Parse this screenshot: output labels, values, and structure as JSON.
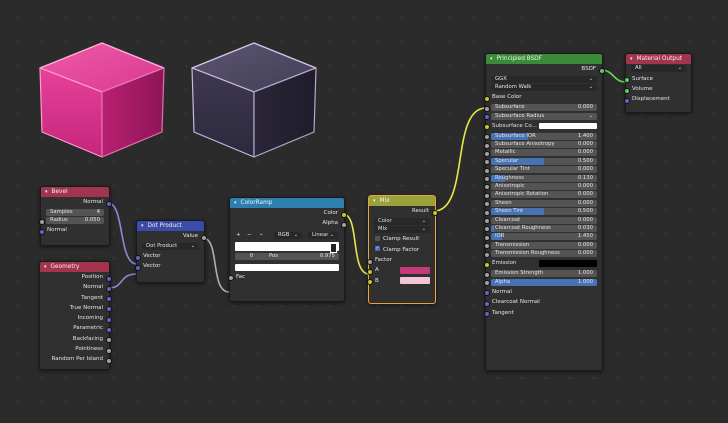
{
  "colors": {
    "bevel": "#a2344d",
    "dot": "#3a4ba8",
    "geometry": "#a2344d",
    "ramp": "#2d7fb0",
    "mix": "#9aa23a",
    "bsdf": "#3a8a3a",
    "output": "#a2344d",
    "pink": "#c53b7a",
    "pink_light": "#f2c4d9",
    "white": "#ffffff",
    "black": "#000000"
  },
  "bevel": {
    "title": "Bevel",
    "out_normal": "Normal",
    "samples_label": "Samples",
    "samples_value": "4",
    "radius_label": "Radius",
    "radius_value": "0.050",
    "in_normal": "Normal"
  },
  "geometry": {
    "title": "Geometry",
    "outputs": [
      "Position",
      "Normal",
      "Tangent",
      "True Normal",
      "Incoming",
      "Parametric",
      "Backfacing",
      "Pointiness",
      "Random Per Island"
    ]
  },
  "dot": {
    "title": "Dot Product",
    "out_value": "Value",
    "mode": "Dot Product",
    "in1": "Vector",
    "in2": "Vector"
  },
  "ramp": {
    "title": "ColorRamp",
    "out_color": "Color",
    "out_alpha": "Alpha",
    "plus": "+",
    "minus": "−",
    "mode": "RGB",
    "interp": "Linear",
    "index": "0",
    "pos_label": "Pos",
    "pos_value": "0.975",
    "in_fac": "Fac"
  },
  "mix": {
    "title": "Mix",
    "out_result": "Result",
    "type": "Color",
    "blend": "Mix",
    "clamp_result": "Clamp Result",
    "clamp_factor": "Clamp Factor",
    "factor": "Factor",
    "a": "A",
    "b": "B"
  },
  "bsdf": {
    "title": "Principled BSDF",
    "out": "BSDF",
    "dist": "GGX",
    "sss_method": "Random Walk",
    "base_color": "Base Color",
    "subsurface_label": "Subsurface",
    "subsurface_value": "0.000",
    "sss_radius": "Subsurface Radius",
    "sss_color": "Subsurface Co...",
    "fields": [
      {
        "label": "Subsurface IOR",
        "value": "1.400",
        "fill": 0.35
      },
      {
        "label": "Subsurface Anisotropy",
        "value": "0.000",
        "fill": 0
      },
      {
        "label": "Metallic",
        "value": "0.000",
        "fill": 0
      },
      {
        "label": "Specular",
        "value": "0.500",
        "fill": 0.5
      },
      {
        "label": "Specular Tint",
        "value": "0.000",
        "fill": 0
      },
      {
        "label": "Roughness",
        "value": "0.130",
        "fill": 0.13
      },
      {
        "label": "Anisotropic",
        "value": "0.000",
        "fill": 0
      },
      {
        "label": "Anisotropic Rotation",
        "value": "0.000",
        "fill": 0
      },
      {
        "label": "Sheen",
        "value": "0.000",
        "fill": 0
      },
      {
        "label": "Sheen Tint",
        "value": "0.500",
        "fill": 0.5
      },
      {
        "label": "Clearcoat",
        "value": "0.000",
        "fill": 0
      },
      {
        "label": "Clearcoat Roughness",
        "value": "0.030",
        "fill": 0.03
      },
      {
        "label": "IOR",
        "value": "1.450",
        "fill": 0.1
      },
      {
        "label": "Transmission",
        "value": "0.000",
        "fill": 0
      },
      {
        "label": "Transmission Roughness",
        "value": "0.000",
        "fill": 0
      }
    ],
    "emission": "Emission",
    "emission_strength_label": "Emission Strength",
    "emission_strength_value": "1.000",
    "alpha_label": "Alpha",
    "alpha_value": "1.000",
    "normal": "Normal",
    "clearcoat_normal": "Clearcoat Normal",
    "tangent": "Tangent"
  },
  "output": {
    "title": "Material Output",
    "target": "All",
    "surface": "Surface",
    "volume": "Volume",
    "displacement": "Displacement"
  }
}
